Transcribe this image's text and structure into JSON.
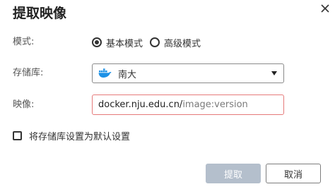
{
  "dialog": {
    "title": "提取映像",
    "close_icon": "close-icon"
  },
  "mode": {
    "label": "模式:",
    "options": [
      {
        "label": "基本模式",
        "selected": true
      },
      {
        "label": "高级模式",
        "selected": false
      }
    ]
  },
  "repository": {
    "label": "存储库:",
    "selected": "南大",
    "icon": "docker-icon"
  },
  "image": {
    "label": "映像:",
    "value": "docker.nju.edu.cn/",
    "placeholder": "image:version"
  },
  "default_checkbox": {
    "label": "将存储库设置为默认设置",
    "checked": false
  },
  "buttons": {
    "submit_label": "提取",
    "cancel_label": "取消"
  },
  "colors": {
    "primary_disabled": "#b4bfcc",
    "input_error_border": "#e57a7a",
    "docker_blue": "#1d91e6"
  }
}
